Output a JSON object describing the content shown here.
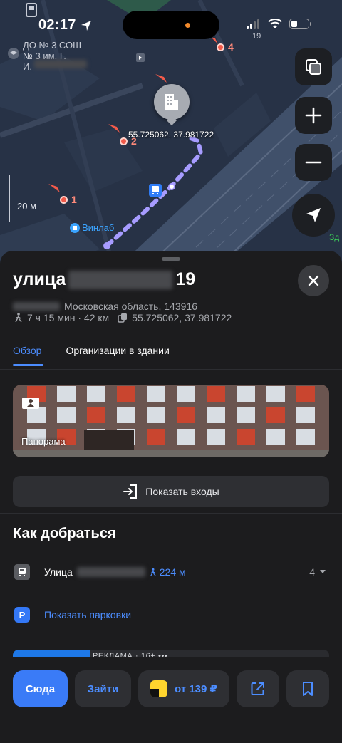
{
  "status_bar": {
    "time": "02:17"
  },
  "map": {
    "school_label": "ДО № 3 СОШ\n№ 3 им. Г.\nИ.",
    "number_19": "19",
    "poi_1": "1",
    "poi_2": "2",
    "poi_4": "4",
    "coordinates_label": "55.725062, 37.981722",
    "scale_label": "20 м",
    "vinlab_label": "Винлаб",
    "edge_label": "Зд",
    "buttons": {
      "layers_icon": "layers-icon",
      "zoom_in_icon": "plus-icon",
      "zoom_out_icon": "minus-icon",
      "locate_icon": "location-arrow-icon"
    }
  },
  "card": {
    "title_prefix": "улица",
    "title_suffix": "19",
    "address": "Московская область, 143916",
    "walk_time": "7 ч 15 мин · 42 км",
    "coordinates": "55.725062, 37.981722",
    "tabs": [
      {
        "label": "Обзор",
        "active": true
      },
      {
        "label": "Организации в здании",
        "active": false
      }
    ],
    "panorama_label": "Панорама",
    "entrances_button": "Показать входы",
    "directions_title": "Как добраться",
    "transit": {
      "name": "Улица",
      "distance": "224 м",
      "lines": "4"
    },
    "parking_link": "Показать парковки",
    "ad_label": "РЕКЛАМА · 16+ •••"
  },
  "actions": {
    "here": "Сюда",
    "go": "Зайти",
    "taxi": "от 139 ₽",
    "share_icon": "share-icon",
    "bookmark_icon": "bookmark-icon"
  },
  "colors": {
    "accent": "#4c8dff",
    "primary_button": "#3a7bf7",
    "map_background": "#283347",
    "route": "#a79cff",
    "poi": "#f25a4a",
    "sheet": "#1c1c1e"
  }
}
